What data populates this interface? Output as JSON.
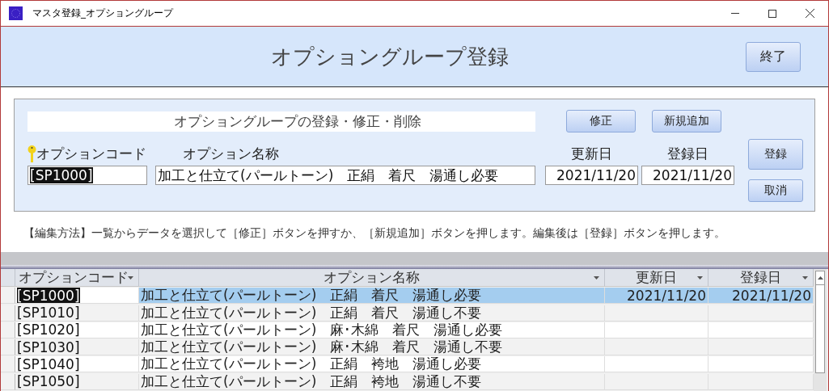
{
  "window": {
    "title": "マスタ登録_オプショングループ"
  },
  "header": {
    "title": "オプショングループ登録",
    "exit_button": "終了"
  },
  "form": {
    "title": "オプショングループの登録・修正・削除",
    "top_buttons": [
      "修正",
      "新規追加"
    ],
    "code": {
      "label": "オプションコード",
      "value": "[SP1000]",
      "highlighted": true
    },
    "name": {
      "label": "オプション名称",
      "value": "加工と仕立て(パールトーン)　正絹　着尺　湯通し必要"
    },
    "dates": [
      {
        "label": "更新日",
        "value": "2021/11/20"
      },
      {
        "label": "登録日",
        "value": "2021/11/20"
      }
    ],
    "side_buttons": [
      "登録",
      "取消"
    ]
  },
  "instructions": "【編集方法】一覧からデータを選択して［修正］ボタンを押すか、［新規追加］ボタンを押します。編集後は［登録］ボタンを押します。",
  "table": {
    "columns": [
      "オプションコード",
      "オプション名称",
      "更新日",
      "登録日"
    ],
    "rows": [
      {
        "code": "[SP1000]",
        "name": "加工と仕立て(パールトーン)　正絹　着尺　湯通し必要",
        "updated": "2021/11/20",
        "registered": "2021/11/20",
        "selected": true
      },
      {
        "code": "[SP1010]",
        "name": "加工と仕立て(パールトーン)　正絹　着尺　湯通し不要",
        "selected": false
      },
      {
        "code": "[SP1020]",
        "name": "加工と仕立て(パールトーン)　麻･木綿　着尺　湯通し必要",
        "selected": false
      },
      {
        "code": "[SP1030]",
        "name": "加工と仕立て(パールトーン)　麻･木綿　着尺　湯通し不要",
        "selected": false
      },
      {
        "code": "[SP1040]",
        "name": "加工と仕立て(パールトーン)　正絹　袴地　湯通し必要",
        "selected": false
      },
      {
        "code": "[SP1050]",
        "name": "加工と仕立て(パールトーン)　正絹　袴地　湯通し不要",
        "selected": false
      }
    ]
  }
}
